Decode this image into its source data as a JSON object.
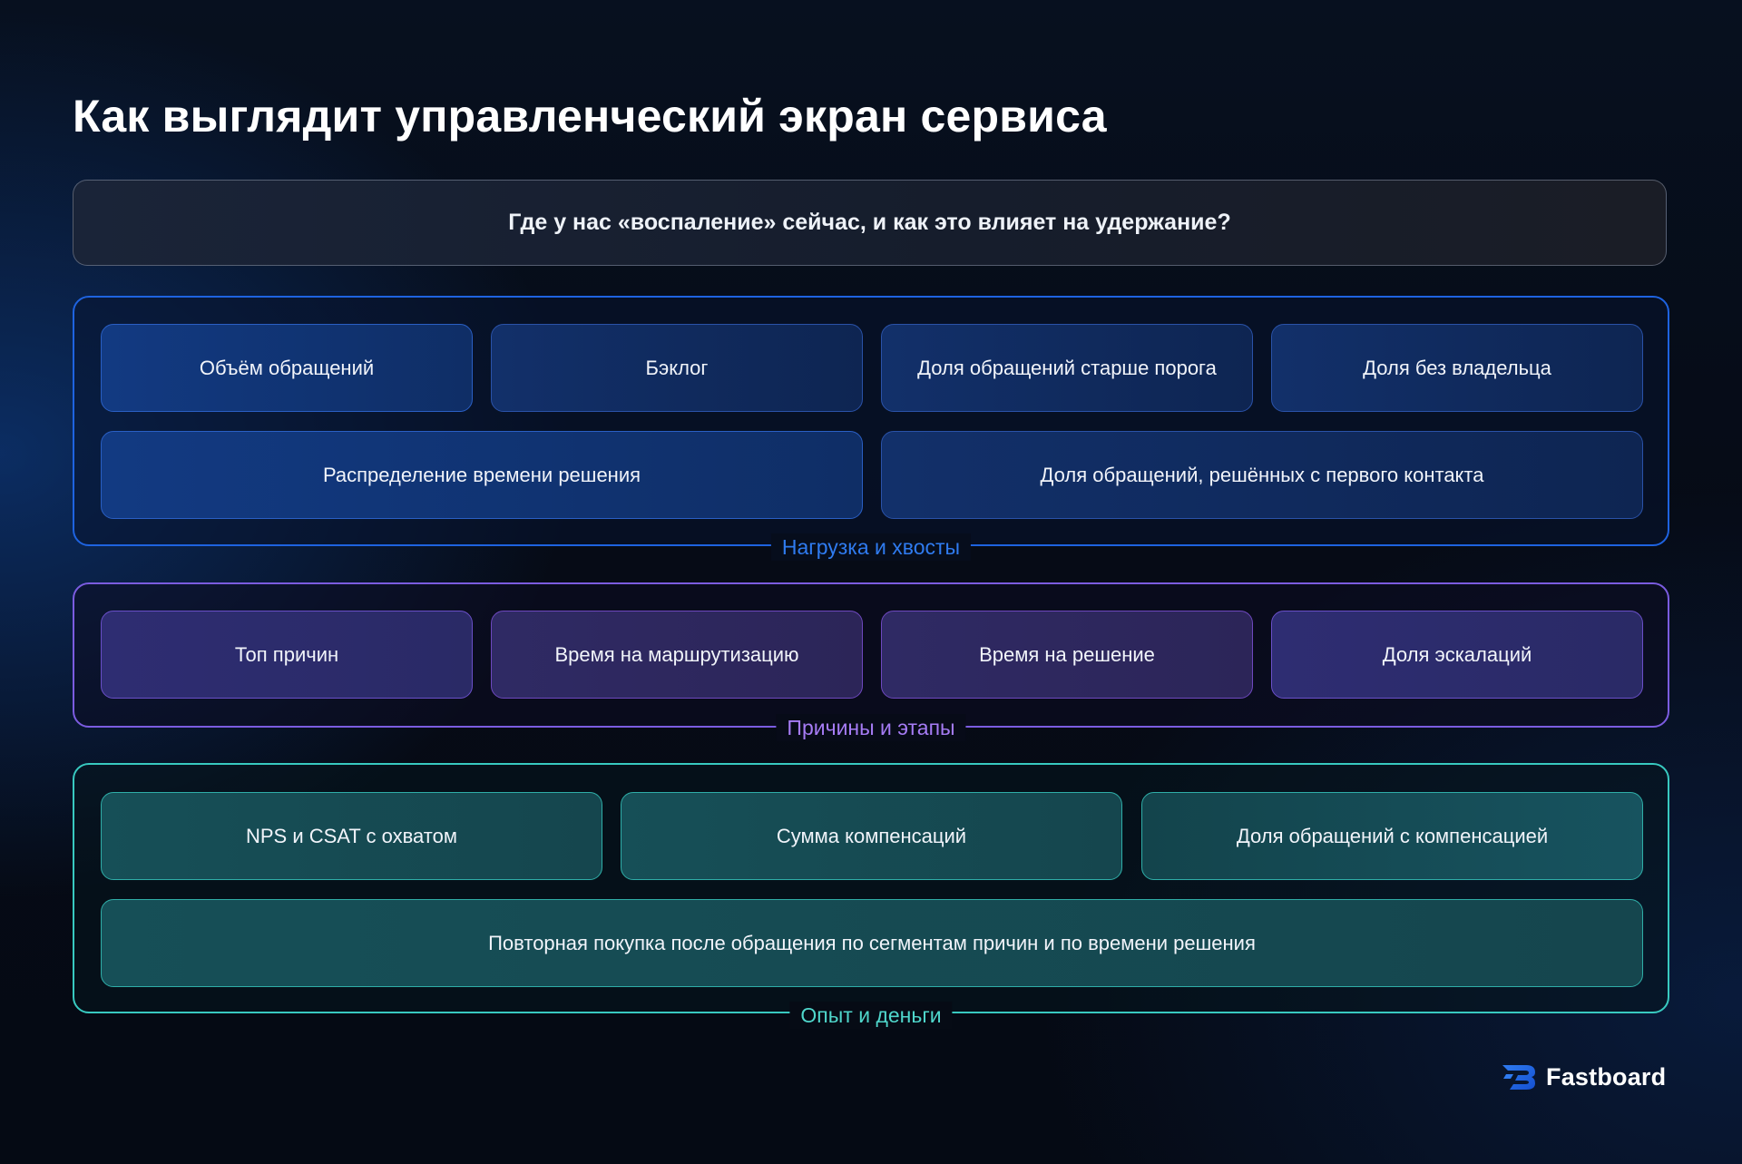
{
  "title": "Как выглядит управленческий экран сервиса",
  "question": "Где у нас «воспаление» сейчас, и как это влияет на удержание?",
  "groups": {
    "load": {
      "label": "Нагрузка и хвосты",
      "row1": [
        "Объём обращений",
        "Бэклог",
        "Доля обращений старше порога",
        "Доля без владельца"
      ],
      "row2": [
        "Распределение времени решения",
        "Доля обращений, решённых с первого контакта"
      ]
    },
    "causes": {
      "label": "Причины и этапы",
      "row1": [
        "Топ причин",
        "Время на маршрутизацию",
        "Время на решение",
        "Доля эскалаций"
      ]
    },
    "experience": {
      "label": "Опыт и деньги",
      "row1": [
        "NPS и CSAT с охватом",
        "Сумма компенсаций",
        "Доля обращений с компенсацией"
      ],
      "row2": [
        "Повторная покупка после обращения по сегментам причин и по времени решения"
      ]
    }
  },
  "brand": {
    "name": "Fastboard",
    "icon": "fastboard-logo-icon"
  },
  "colors": {
    "blue": "#1e63e0",
    "purple": "#7b5ce0",
    "teal": "#38c9c0",
    "background": "#060b16"
  }
}
